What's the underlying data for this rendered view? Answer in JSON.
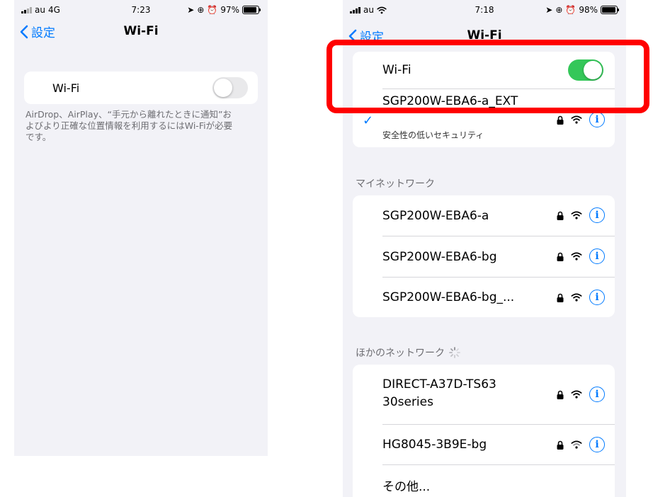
{
  "left_screen": {
    "status": {
      "carrier": "au",
      "network": "4G",
      "time": "7:23",
      "battery": "97%",
      "battery_level": 0.97
    },
    "nav": {
      "back_label": "設定",
      "title": "Wi-Fi"
    },
    "wifi_row": {
      "label": "Wi-Fi",
      "toggle_on": false
    },
    "footnote": "AirDrop、AirPlay、“手元から離れたときに通知”およびより正確な位置情報を利用するにはWi-Fiが必要です。"
  },
  "right_screen": {
    "status": {
      "carrier": "au",
      "time": "7:18",
      "battery": "98%",
      "battery_level": 0.98
    },
    "nav": {
      "back_label": "設定",
      "title": "Wi-Fi"
    },
    "wifi_row": {
      "label": "Wi-Fi",
      "toggle_on": true
    },
    "connected": {
      "name": "SGP200W-EBA6-a_EXT",
      "subtitle": "安全性の低いセキュリティ"
    },
    "my_networks": {
      "header": "マイネットワーク",
      "items": [
        {
          "name": "SGP200W-EBA6-a"
        },
        {
          "name": "SGP200W-EBA6-bg"
        },
        {
          "name": "SGP200W-EBA6-bg_..."
        }
      ]
    },
    "other_networks": {
      "header": "ほかのネットワーク",
      "items": [
        {
          "name": "DIRECT-A37D-TS6330series"
        },
        {
          "name": "HG8045-3B9E-bg"
        }
      ],
      "other_label": "その他..."
    }
  },
  "colors": {
    "accent": "#007aff",
    "toggle_on": "#34c759",
    "highlight": "#ff0000",
    "background": "#f2f2f7"
  },
  "icons": [
    "chevron-left-icon",
    "lock-icon",
    "wifi-icon",
    "info-icon",
    "checkmark-icon",
    "location-icon",
    "alarm-icon",
    "spinner-icon",
    "signal-icon",
    "battery-icon"
  ]
}
